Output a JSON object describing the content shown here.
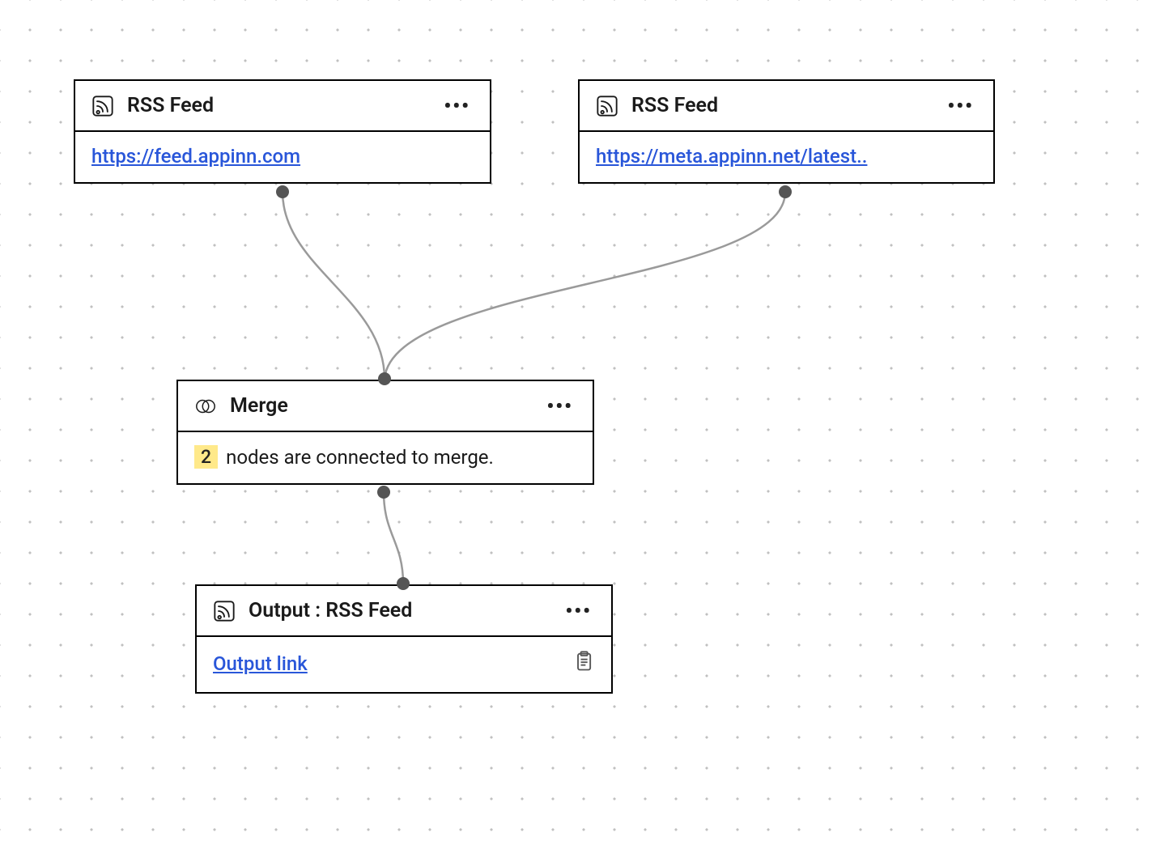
{
  "nodes": {
    "rss1": {
      "title": "RSS Feed",
      "url": "https://feed.appinn.com",
      "menu": "•••"
    },
    "rss2": {
      "title": "RSS Feed",
      "url": "https://meta.appinn.net/latest..",
      "menu": "•••"
    },
    "merge": {
      "title": "Merge",
      "count": "2",
      "text": "nodes are connected to merge.",
      "menu": "•••"
    },
    "output": {
      "title": "Output : RSS Feed",
      "link_label": "Output link",
      "menu": "•••"
    }
  },
  "colors": {
    "link": "#2956d9",
    "badge_bg": "#ffe98a",
    "port": "#555555",
    "wire": "#9a9a9a"
  }
}
